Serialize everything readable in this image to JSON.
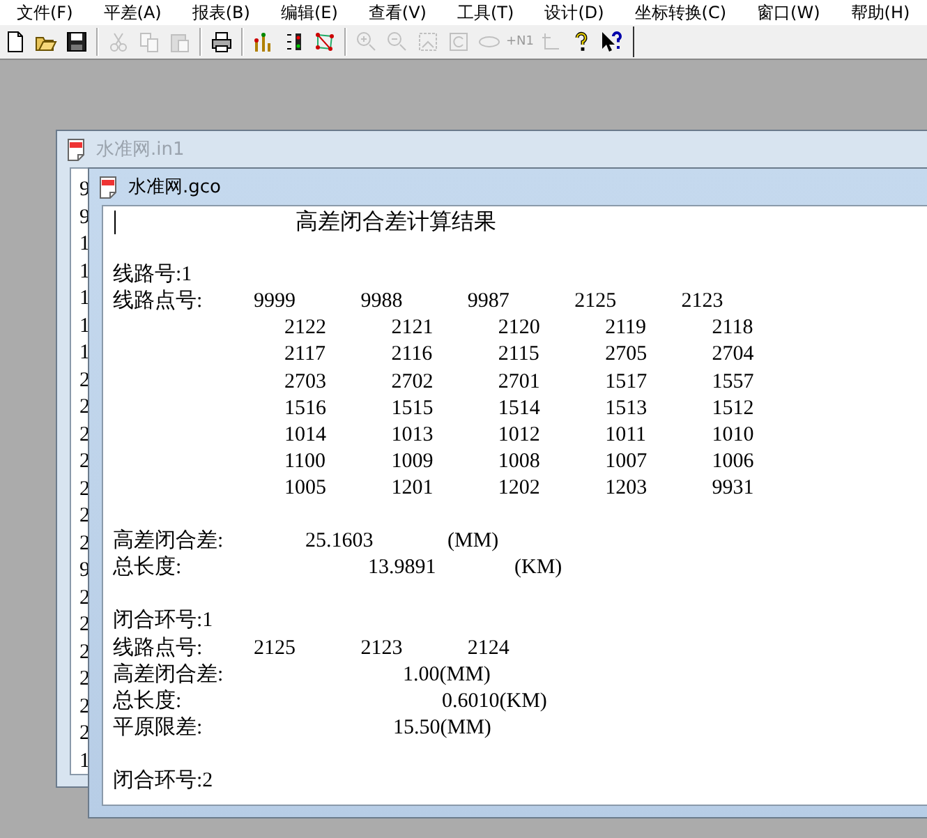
{
  "menu_bar": {
    "items": [
      "文件(F)",
      "平差(A)",
      "报表(B)",
      "编辑(E)",
      "查看(V)",
      "工具(T)",
      "设计(D)",
      "坐标转换(C)",
      "窗口(W)",
      "帮助(H)"
    ]
  },
  "toolbar": {
    "buttons": [
      {
        "kind": "new",
        "disabled": false
      },
      {
        "kind": "open",
        "disabled": false
      },
      {
        "kind": "save",
        "disabled": false
      },
      {
        "kind": "sep"
      },
      {
        "kind": "cut",
        "disabled": true
      },
      {
        "kind": "copy",
        "disabled": true
      },
      {
        "kind": "paste",
        "disabled": true
      },
      {
        "kind": "sep"
      },
      {
        "kind": "print",
        "disabled": false
      },
      {
        "kind": "sep"
      },
      {
        "kind": "level",
        "disabled": false
      },
      {
        "kind": "numbers",
        "disabled": false
      },
      {
        "kind": "network",
        "disabled": false
      },
      {
        "kind": "sep"
      },
      {
        "kind": "zoom-in",
        "disabled": true
      },
      {
        "kind": "zoom-out",
        "disabled": true
      },
      {
        "kind": "frame",
        "disabled": true
      },
      {
        "kind": "refresh",
        "disabled": true
      },
      {
        "kind": "ellipse",
        "disabled": true
      },
      {
        "kind": "text",
        "label": "+N1",
        "disabled": true
      },
      {
        "kind": "axes",
        "disabled": true
      },
      {
        "kind": "help",
        "disabled": false
      },
      {
        "kind": "whats-this",
        "disabled": false
      }
    ]
  },
  "back_window": {
    "title": "水准网.in1",
    "active": false,
    "lines": [
      "9",
      "9",
      "1",
      "1",
      "1",
      "1",
      "1",
      "2",
      "2",
      "2",
      "2",
      "2",
      "2",
      "2",
      "9",
      "2",
      "2",
      "2",
      "2",
      "2",
      "2",
      "1"
    ]
  },
  "front_window": {
    "title": "水准网.gco",
    "active": true,
    "report": [
      {
        "kind": "title",
        "text": "高差闭合差计算结果"
      },
      {
        "kind": "blank"
      },
      {
        "kind": "text",
        "text": "线路号:1"
      },
      {
        "kind": "points",
        "label": "线路点号:",
        "values": [
          "9999",
          "9988",
          "9987",
          "2125",
          "2123"
        ]
      },
      {
        "kind": "points",
        "values": [
          "2122",
          "2121",
          "2120",
          "2119",
          "2118"
        ]
      },
      {
        "kind": "points",
        "values": [
          "2117",
          "2116",
          "2115",
          "2705",
          "2704"
        ]
      },
      {
        "kind": "points",
        "values": [
          "2703",
          "2702",
          "2701",
          "1517",
          "1557"
        ]
      },
      {
        "kind": "points",
        "values": [
          "1516",
          "1515",
          "1514",
          "1513",
          "1512"
        ]
      },
      {
        "kind": "points",
        "values": [
          "1014",
          "1013",
          "1012",
          "1011",
          "1010"
        ]
      },
      {
        "kind": "points",
        "values": [
          "1100",
          "1009",
          "1008",
          "1007",
          "1006"
        ]
      },
      {
        "kind": "points",
        "values": [
          "1005",
          "1201",
          "1202",
          "1203",
          "9931"
        ]
      },
      {
        "kind": "blank"
      },
      {
        "kind": "field",
        "label": "高差闭合差:",
        "value": "25.1603",
        "unit": "(MM)"
      },
      {
        "kind": "field",
        "label": "总长度:",
        "value": "13.9891",
        "unit": "(KM)"
      },
      {
        "kind": "blank"
      },
      {
        "kind": "text",
        "text": "闭合环号:1"
      },
      {
        "kind": "points",
        "label": "线路点号:",
        "values": [
          "2125",
          "2123",
          "2124"
        ]
      },
      {
        "kind": "field",
        "label": "高差闭合差:",
        "value": "1.00(MM)"
      },
      {
        "kind": "field",
        "label": "总长度:",
        "value": "0.6010(KM)"
      },
      {
        "kind": "field",
        "label": "平原限差:",
        "value": "15.50(MM)"
      },
      {
        "kind": "blank"
      },
      {
        "kind": "text",
        "text": "闭合环号:2"
      }
    ]
  }
}
